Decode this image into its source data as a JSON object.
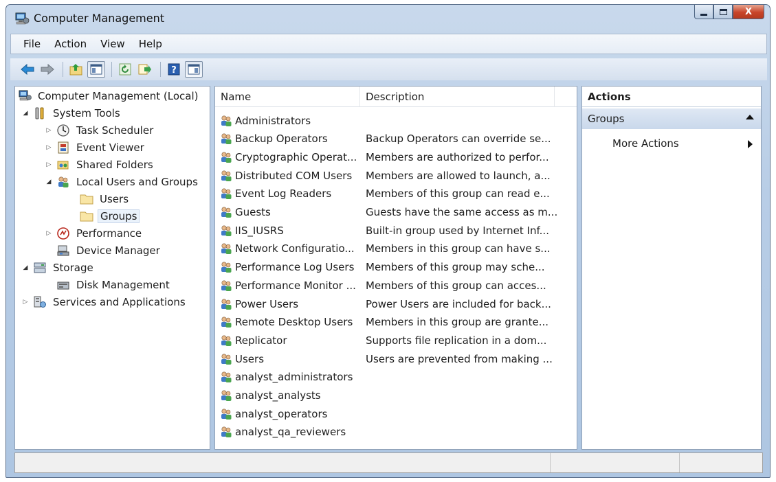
{
  "window": {
    "title": "Computer Management",
    "close_label": "X"
  },
  "menu": [
    "File",
    "Action",
    "View",
    "Help"
  ],
  "tree": {
    "root": "Computer Management (Local)",
    "system_tools": "System Tools",
    "task_scheduler": "Task Scheduler",
    "event_viewer": "Event Viewer",
    "shared_folders": "Shared Folders",
    "local_users_groups": "Local Users and Groups",
    "users": "Users",
    "groups": "Groups",
    "performance": "Performance",
    "device_manager": "Device Manager",
    "storage": "Storage",
    "disk_management": "Disk Management",
    "services_apps": "Services and Applications"
  },
  "list": {
    "columns": [
      "Name",
      "Description"
    ],
    "rows": [
      {
        "name": "Administrators",
        "desc": ""
      },
      {
        "name": "Backup Operators",
        "desc": "Backup Operators can override se..."
      },
      {
        "name": "Cryptographic Operat...",
        "desc": "Members are authorized to perfor..."
      },
      {
        "name": "Distributed COM Users",
        "desc": "Members are allowed to launch, a..."
      },
      {
        "name": "Event Log Readers",
        "desc": "Members of this group can read e..."
      },
      {
        "name": "Guests",
        "desc": "Guests have the same access as m..."
      },
      {
        "name": "IIS_IUSRS",
        "desc": "Built-in group used by Internet Inf..."
      },
      {
        "name": "Network Configuratio...",
        "desc": "Members in this group can have s..."
      },
      {
        "name": "Performance Log Users",
        "desc": "Members of this group may sche..."
      },
      {
        "name": "Performance Monitor ...",
        "desc": "Members of this group can acces..."
      },
      {
        "name": "Power Users",
        "desc": "Power Users are included for back..."
      },
      {
        "name": "Remote Desktop Users",
        "desc": "Members in this group are grante..."
      },
      {
        "name": "Replicator",
        "desc": "Supports file replication in a dom..."
      },
      {
        "name": "Users",
        "desc": "Users are prevented from making ..."
      },
      {
        "name": "analyst_administrators",
        "desc": ""
      },
      {
        "name": "analyst_analysts",
        "desc": ""
      },
      {
        "name": "analyst_operators",
        "desc": ""
      },
      {
        "name": "analyst_qa_reviewers",
        "desc": ""
      }
    ]
  },
  "actions": {
    "title": "Actions",
    "group": "Groups",
    "more": "More Actions"
  }
}
